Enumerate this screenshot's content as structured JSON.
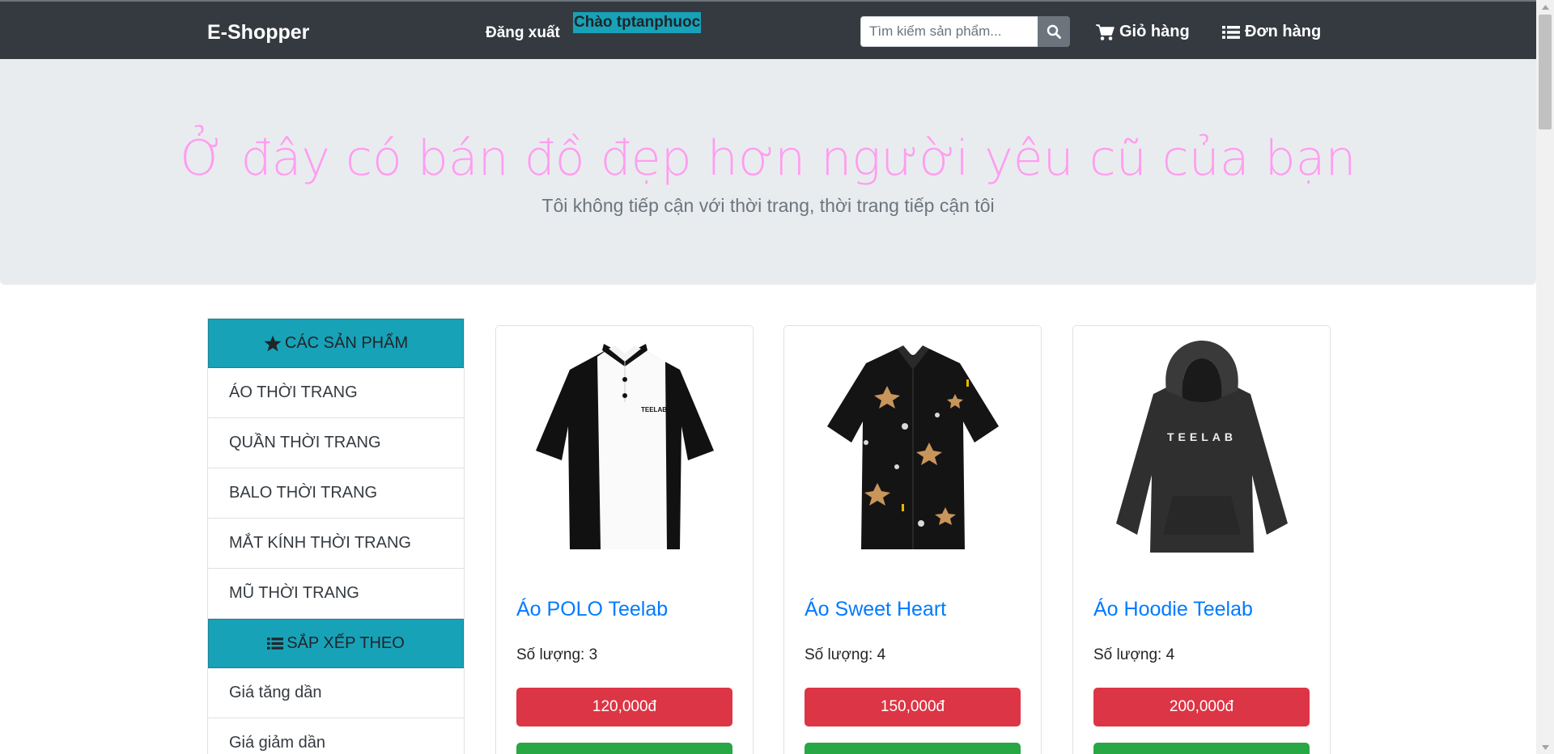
{
  "navbar": {
    "brand": "E-Shopper",
    "logout_label": "Đăng xuất",
    "greeting": "Chào tptanphuoc",
    "search_placeholder": "Tìm kiếm sản phẩm...",
    "search_icon": "search-icon",
    "cart_label": "Giỏ hàng",
    "cart_icon": "shopping-cart-icon",
    "orders_label": "Đơn hàng",
    "orders_icon": "list-icon"
  },
  "jumbotron": {
    "title": "Ở đây có bán đồ đẹp hơn người yêu cũ của bạn",
    "subtitle": "Tôi không tiếp cận với thời trang, thời trang tiếp cận tôi"
  },
  "sidebar": {
    "categories_header": "CÁC SẢN PHẨM",
    "categories_icon": "star-icon",
    "categories": [
      "ÁO THỜI TRANG",
      "QUẦN THỜI TRANG",
      "BALO THỜI TRANG",
      "MẮT KÍNH THỜI TRANG",
      "MŨ THỜI TRANG"
    ],
    "sort_header": "SẮP XẾP THEO",
    "sort_icon": "list-icon",
    "sort_options": [
      "Giá tăng dần",
      "Giá giảm dần"
    ]
  },
  "products": [
    {
      "name": "Áo POLO Teelab",
      "quantity": "Số lượng: 3",
      "price": "120,000đ",
      "image_label": "TEELAB",
      "image_icon": "polo-shirt-image"
    },
    {
      "name": "Áo Sweet Heart",
      "quantity": "Số lượng: 4",
      "price": "150,000đ",
      "image_label": "",
      "image_icon": "patterned-shirt-image"
    },
    {
      "name": "Áo Hoodie Teelab",
      "quantity": "Số lượng: 4",
      "price": "200,000đ",
      "image_label": "TEELAB",
      "image_icon": "hoodie-image"
    }
  ],
  "colors": {
    "navbar": "#343a40",
    "accent_teal": "#17a2b8",
    "title_pink": "#ff9df0",
    "price_red": "#dc3545",
    "add_green": "#28a745",
    "link_blue": "#007bff"
  }
}
